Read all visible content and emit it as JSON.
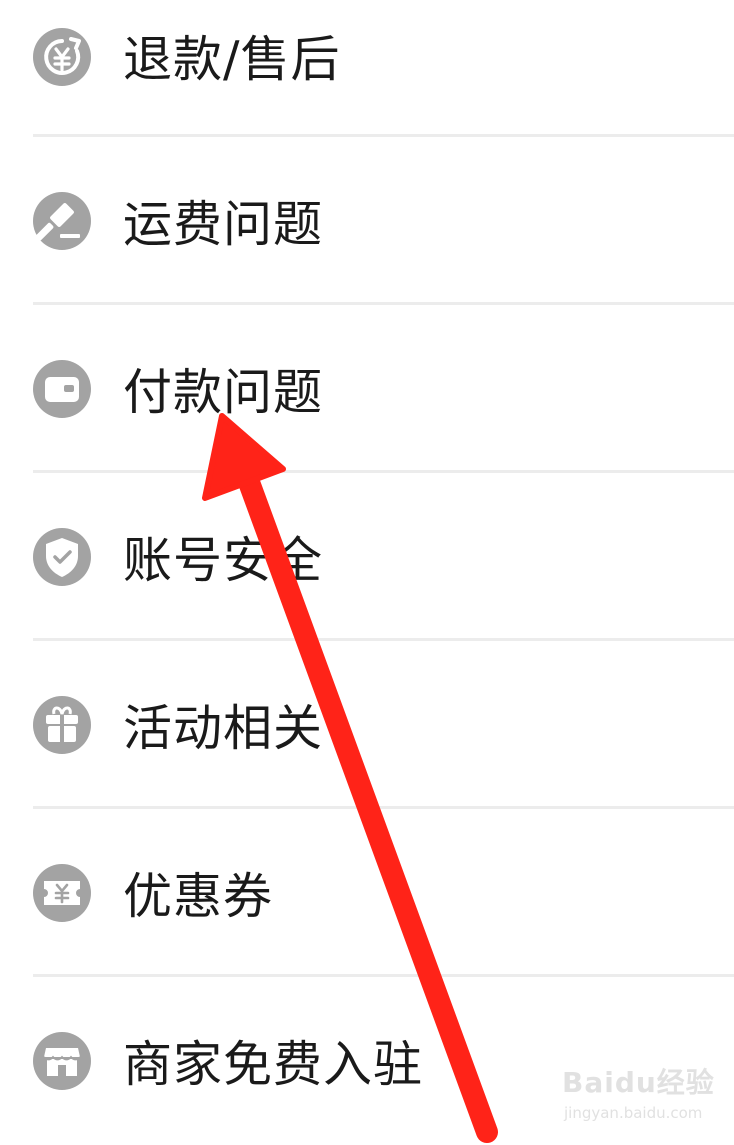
{
  "menu": {
    "items": [
      {
        "icon": "refund-yuan-icon",
        "label": "退款/售后"
      },
      {
        "icon": "gavel-icon",
        "label": "运费问题"
      },
      {
        "icon": "wallet-icon",
        "label": "付款问题"
      },
      {
        "icon": "shield-check-icon",
        "label": "账号安全"
      },
      {
        "icon": "gift-icon",
        "label": "活动相关"
      },
      {
        "icon": "coupon-yuan-icon",
        "label": "优惠券"
      },
      {
        "icon": "storefront-icon",
        "label": "商家免费入驻"
      }
    ]
  },
  "annotation": {
    "arrow_color": "#ff2318",
    "points_to": "付款问题"
  },
  "watermark": {
    "brand": "Baidu经验",
    "url": "jingyan.baidu.com"
  },
  "colors": {
    "icon_background": "#a3a3a3",
    "label_text": "#1a1a1a",
    "divider": "#ececec"
  }
}
